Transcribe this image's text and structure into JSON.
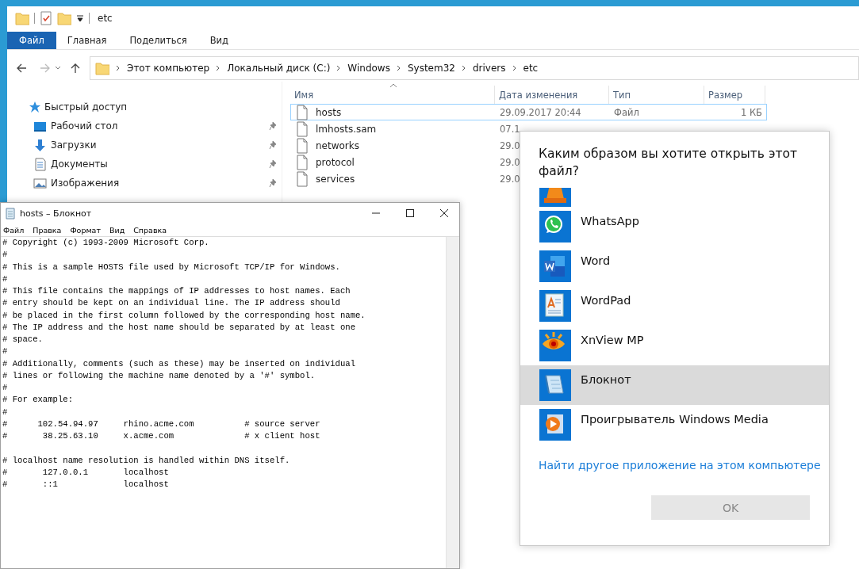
{
  "explorer": {
    "title": "etc",
    "ribbon_tabs": [
      {
        "label": "Файл",
        "selected": true
      },
      {
        "label": "Главная",
        "selected": false
      },
      {
        "label": "Поделиться",
        "selected": false
      },
      {
        "label": "Вид",
        "selected": false
      }
    ],
    "breadcrumb": [
      "Этот компьютер",
      "Локальный диск (C:)",
      "Windows",
      "System32",
      "drivers",
      "etc"
    ],
    "quick_access": {
      "label": "Быстрый доступ",
      "items": [
        {
          "label": "Рабочий стол",
          "pinned": true
        },
        {
          "label": "Загрузки",
          "pinned": true
        },
        {
          "label": "Документы",
          "pinned": true
        },
        {
          "label": "Изображения",
          "pinned": true
        }
      ]
    },
    "columns": [
      "Имя",
      "Дата изменения",
      "Тип",
      "Размер"
    ],
    "files": [
      {
        "name": "hosts",
        "date": "29.09.2017 20:44",
        "type": "Файл",
        "size": "1 КБ",
        "selected": true
      },
      {
        "name": "lmhosts.sam",
        "date": "07.1",
        "selected": false
      },
      {
        "name": "networks",
        "date": "29.0",
        "selected": false
      },
      {
        "name": "protocol",
        "date": "29.0",
        "selected": false
      },
      {
        "name": "services",
        "date": "29.0",
        "selected": false
      }
    ]
  },
  "notepad": {
    "title": "hosts – Блокнот",
    "menu": [
      "Файл",
      "Правка",
      "Формат",
      "Вид",
      "Справка"
    ],
    "content": "# Copyright (c) 1993-2009 Microsoft Corp.\n#\n# This is a sample HOSTS file used by Microsoft TCP/IP for Windows.\n#\n# This file contains the mappings of IP addresses to host names. Each\n# entry should be kept on an individual line. The IP address should\n# be placed in the first column followed by the corresponding host name.\n# The IP address and the host name should be separated by at least one\n# space.\n#\n# Additionally, comments (such as these) may be inserted on individual\n# lines or following the machine name denoted by a '#' symbol.\n#\n# For example:\n#\n#      102.54.94.97     rhino.acme.com          # source server\n#       38.25.63.10     x.acme.com              # x client host\n\n# localhost name resolution is handled within DNS itself.\n#\t127.0.0.1       localhost\n#\t::1             localhost"
  },
  "open_with": {
    "heading": "Каким образом вы хотите открыть этот файл?",
    "apps": [
      {
        "label": "WhatsApp",
        "selected": false
      },
      {
        "label": "Word",
        "selected": false
      },
      {
        "label": "WordPad",
        "selected": false
      },
      {
        "label": "XnView MP",
        "selected": false
      },
      {
        "label": "Блокнот",
        "selected": true
      },
      {
        "label": "Проигрыватель Windows Media",
        "selected": false
      }
    ],
    "link": "Найти другое приложение на этом компьютере",
    "ok_button": {
      "label": "OK",
      "disabled": true
    }
  }
}
